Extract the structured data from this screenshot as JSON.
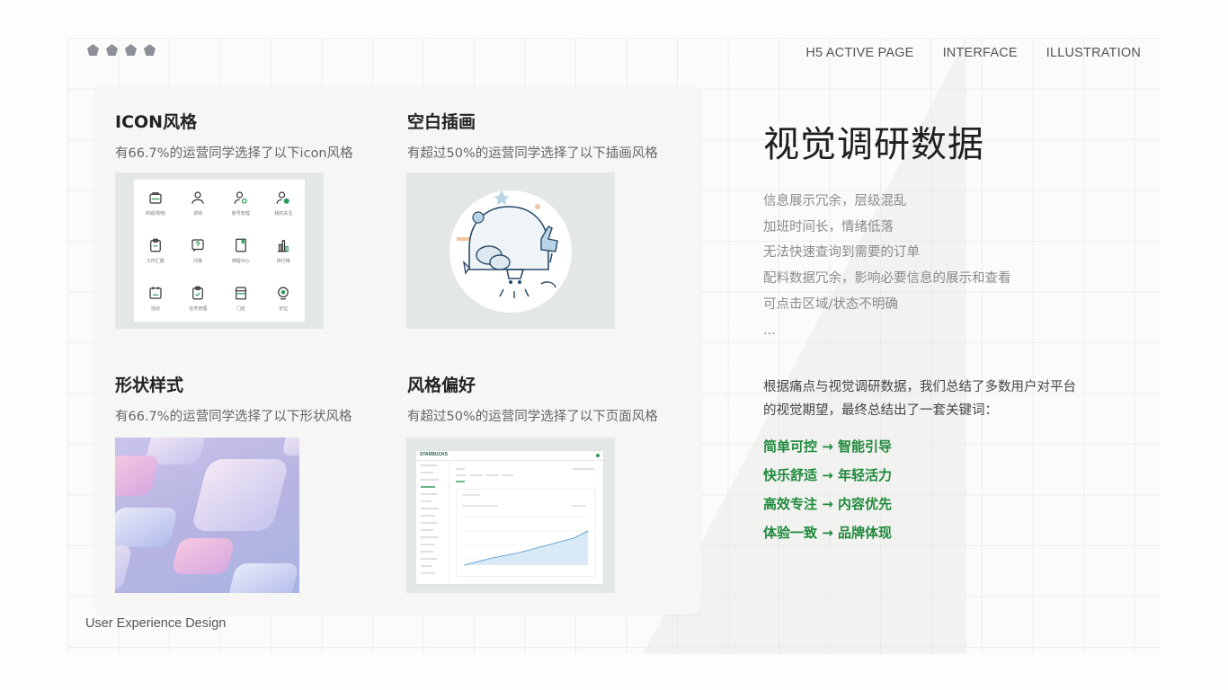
{
  "nav": {
    "items": [
      "H5 ACTIVE PAGE",
      "INTERFACE",
      "ILLUSTRATION"
    ]
  },
  "sections": [
    {
      "title": "ICON风格",
      "subtitle": "有66.7%的运营同学选择了以下icon风格"
    },
    {
      "title": "空白插画",
      "subtitle": "有超过50%的运营同学选择了以下插画风格"
    },
    {
      "title": "形状样式",
      "subtitle": "有66.7%的运营同学选择了以下形状风格"
    },
    {
      "title": "风格偏好",
      "subtitle": "有超过50%的运营同学选择了以下页面风格"
    }
  ],
  "icon_grid": {
    "labels": [
      "商城/购物",
      "讲师",
      "账号管理",
      "我的关注",
      "工作汇报",
      "问答",
      "课程中心",
      "排行榜",
      "活动",
      "任务管理",
      "门店",
      "定位"
    ],
    "icons": [
      "bag-icon",
      "user-icon",
      "user-settings-icon",
      "user-check-icon",
      "clipboard-icon",
      "question-icon",
      "book-icon",
      "bar-chart-icon",
      "calendar-icon",
      "task-icon",
      "store-icon",
      "location-icon"
    ]
  },
  "dashboard_thumb": {
    "brand": "STARBUCKS"
  },
  "footer": {
    "text": "User Experience Design"
  },
  "right_panel": {
    "title": "视觉调研数据",
    "issues": [
      "信息展示冗余，层级混乱",
      "加班时间长，情绪低落",
      "无法快速查询到需要的订单",
      "配料数据冗余，影响必要信息的展示和查看",
      "可点击区域/状态不明确",
      "..."
    ],
    "summary": "根据痛点与视觉调研数据，我们总结了多数用户对平台的视觉期望，最终总结出了一套关键词：",
    "keywords": [
      "简单可控 → 智能引导",
      "快乐舒适 → 年轻活力",
      "高效专注 → 内容优先",
      "体验一致 → 品牌体现"
    ]
  },
  "colors": {
    "accent_green": "#1f8a3c",
    "card_bg": "#f6f6f4",
    "thumb_bg": "#e3e8e6"
  }
}
